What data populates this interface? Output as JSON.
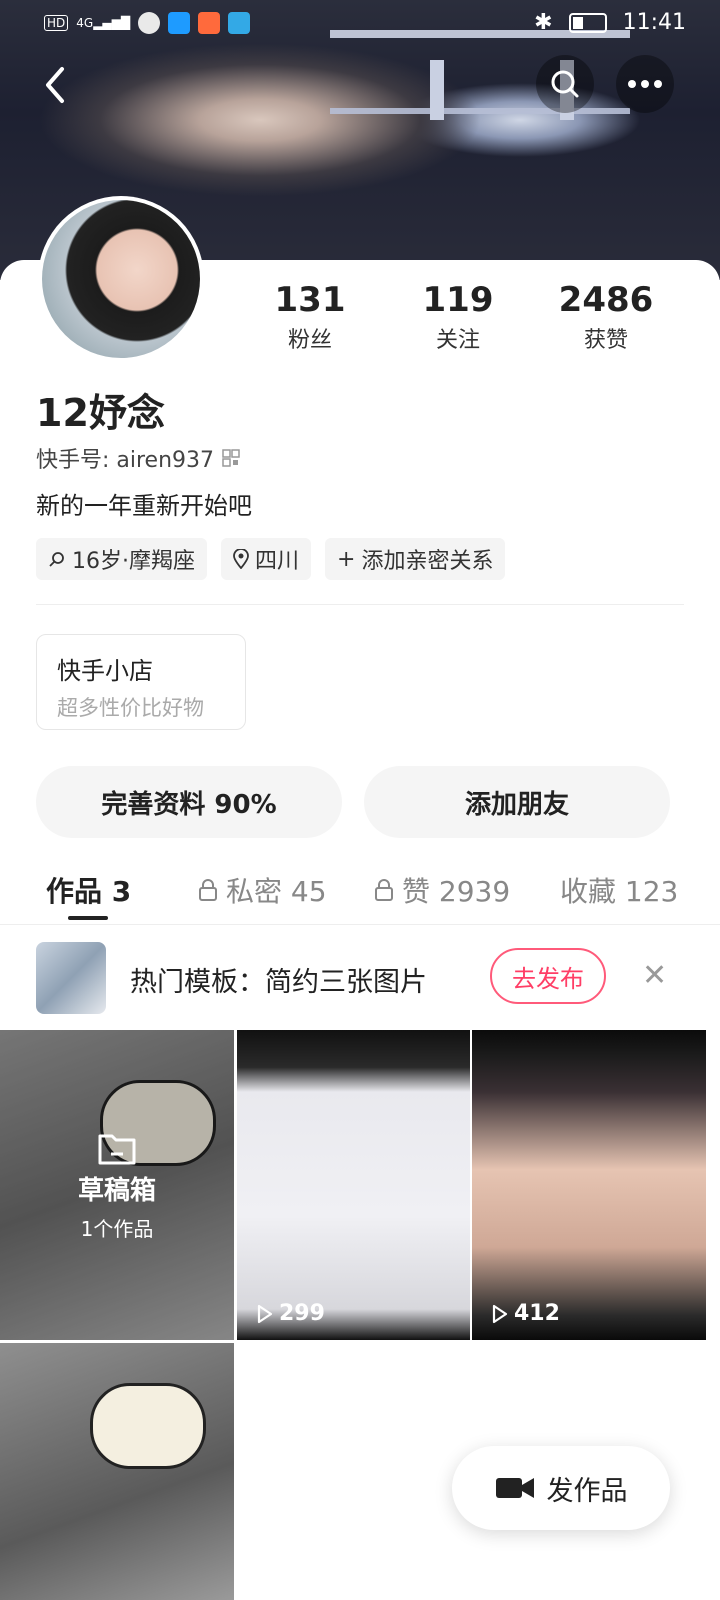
{
  "status_bar": {
    "left_icons": [
      "HD",
      "4G",
      "signal",
      "wechat-icon",
      "search-app-icon",
      "app-icon",
      "book-icon"
    ],
    "time": "11:41"
  },
  "header": {
    "back_icon": "chevron-left-icon",
    "search_icon": "search-icon",
    "more_icon": "more-icon"
  },
  "profile": {
    "name": "12妤念",
    "kuaishou_id": "快手号: airen937",
    "bio": "新的一年重新开始吧",
    "stats": [
      {
        "num": "131",
        "label": "粉丝"
      },
      {
        "num": "119",
        "label": "关注"
      },
      {
        "num": "2486",
        "label": "获赞"
      }
    ],
    "tags": [
      "16岁·摩羯座",
      "四川",
      "添加亲密关系"
    ]
  },
  "shop": {
    "title": "快手小店",
    "subtitle": "超多性价比好物"
  },
  "actions": {
    "complete_profile": "完善资料 90%",
    "add_friend": "添加朋友"
  },
  "tabs": [
    {
      "label": "作品 3"
    },
    {
      "label": "私密 45"
    },
    {
      "label": "赞 2939"
    },
    {
      "label": "收藏 123"
    }
  ],
  "promo": {
    "text": "热门模板：简约三张图片",
    "button": "去发布"
  },
  "grid": {
    "draft_title": "草稿箱",
    "draft_sub": "1个作品",
    "plays": [
      "299",
      "412"
    ]
  },
  "fab": {
    "label": "发作品"
  }
}
